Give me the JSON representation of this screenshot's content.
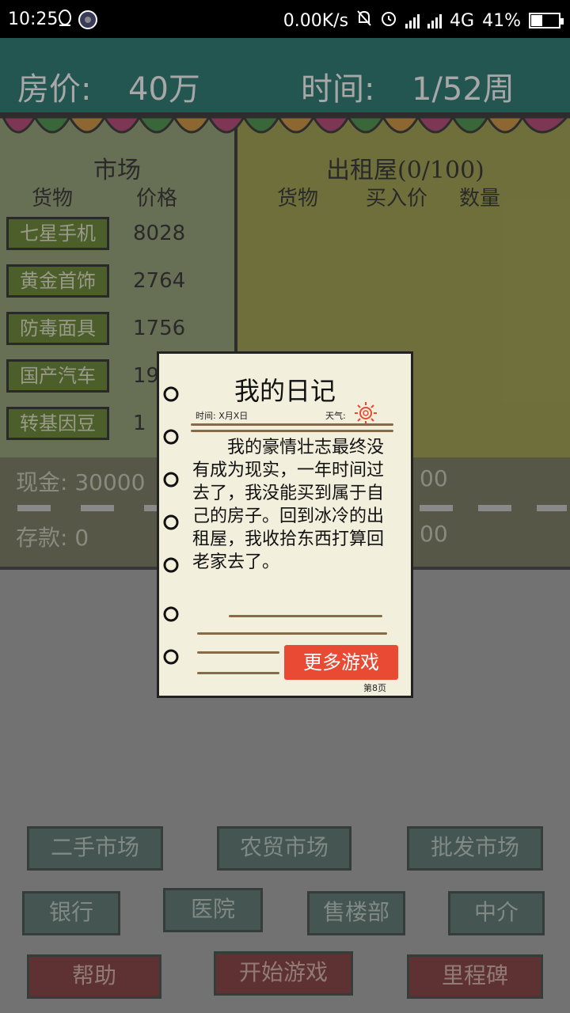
{
  "status_bar": {
    "time": "10:25",
    "network_speed": "0.00K/s",
    "network_type": "4G",
    "battery_percent": "41%",
    "battery_level": 0.41,
    "icons": [
      "qq-icon",
      "app-icon",
      "mute-bell-icon",
      "alarm-icon",
      "signal-icon",
      "signal-icon",
      "battery-icon"
    ]
  },
  "header": {
    "house_price_label": "房价:",
    "house_price_value": "40万",
    "time_label": "时间:",
    "time_value": "1/52周"
  },
  "market": {
    "title": "市场",
    "col_goods": "货物",
    "col_price": "价格",
    "items": [
      {
        "name": "七星手机",
        "price": "8028"
      },
      {
        "name": "黄金首饰",
        "price": "2764"
      },
      {
        "name": "防毒面具",
        "price": "1756"
      },
      {
        "name": "国产汽车",
        "price": "19"
      },
      {
        "name": "转基因豆",
        "price": "1"
      }
    ]
  },
  "rent": {
    "title": "出租屋(0/100)",
    "col_goods": "货物",
    "col_buy_price": "买入价",
    "col_qty": "数量"
  },
  "finance": {
    "cash_label": "现金: 30000",
    "deposit_label": "存款: 0",
    "cash_right": "00",
    "deposit_right": "00"
  },
  "menu": {
    "row1": [
      "二手市场",
      "农贸市场",
      "批发市场"
    ],
    "row2": [
      "银行",
      "医院",
      "售楼部",
      "中介"
    ],
    "row3": [
      "帮助",
      "开始游戏",
      "里程碑"
    ]
  },
  "diary": {
    "title": "我的日记",
    "time_meta": "时间: X月X日",
    "weather_meta": "天气:",
    "body": "我的豪情壮志最终没有成为现实，一年时间过去了，我没能买到属于自己的房子。回到冰冷的出租屋，我收拾东西打算回老家去了。",
    "more_games_button": "更多游戏",
    "page_number": "第8页"
  },
  "colors": {
    "header_teal": "#0f6b63",
    "market_green": "#8a9a68",
    "rent_olive": "#9a9a3c",
    "more_button_red": "#e84a33",
    "paper": "#f3efdd"
  }
}
